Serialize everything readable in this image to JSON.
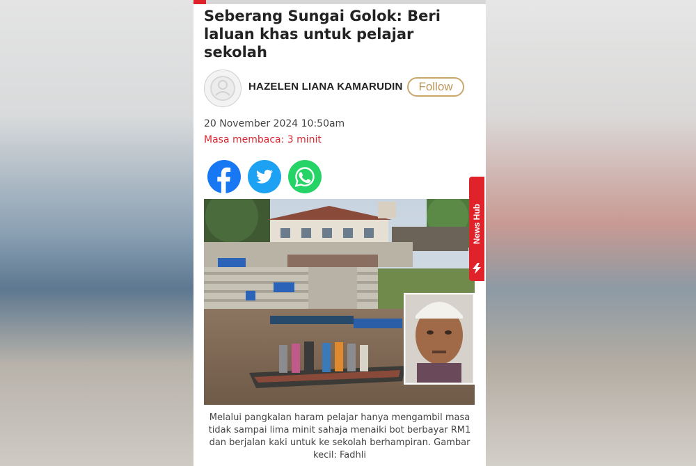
{
  "article": {
    "headline": "Seberang Sungai Golok: Beri laluan khas untuk pelajar sekolah",
    "author": "HAZELEN LIANA KAMARUDIN",
    "follow_label": "Follow",
    "date": "20 November 2024 10:50am",
    "read_time": "Masa membaca: 3 minit",
    "caption": "Melalui pangkalan haram pelajar hanya mengambil masa tidak sampai lima minit sahaja menaiki bot berbayar RM1 dan berjalan kaki untuk ke sekolah berhampiran. Gambar kecil: Fadhli"
  },
  "share": [
    {
      "name": "facebook",
      "icon": "facebook-icon",
      "color": "#1877f2"
    },
    {
      "name": "twitter",
      "icon": "twitter-icon",
      "color": "#1da1f2"
    },
    {
      "name": "whatsapp",
      "icon": "whatsapp-icon",
      "color": "#25d366"
    }
  ],
  "side_tab": {
    "label": "News Hub",
    "icon": "lightning-icon",
    "color": "#e0232a"
  },
  "colors": {
    "accent_red": "#e0232a",
    "follow_gold": "#c9a76c"
  }
}
